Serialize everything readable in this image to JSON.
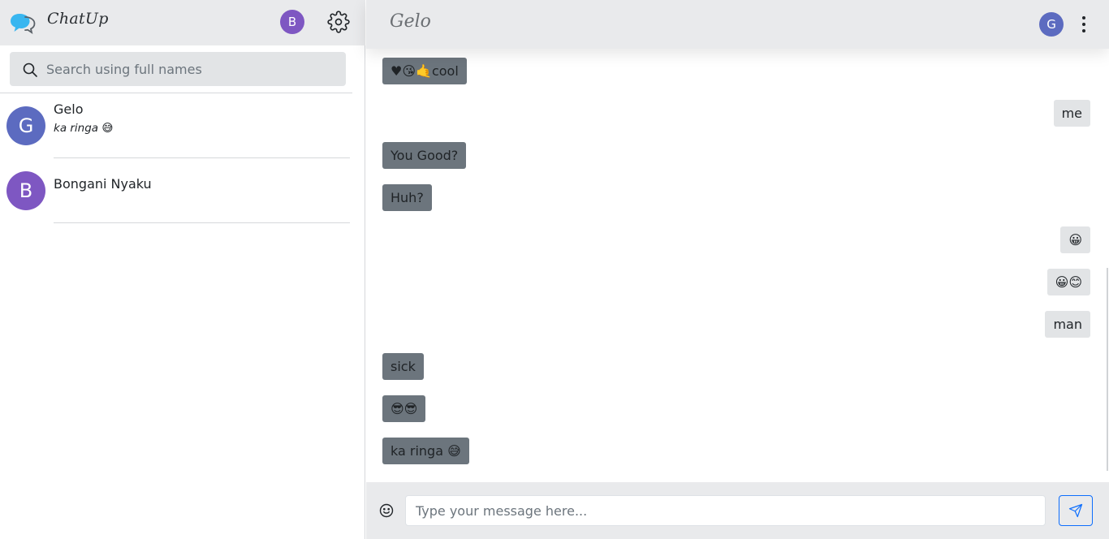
{
  "app": {
    "title": "ChatUp"
  },
  "current_user": {
    "initial": "B"
  },
  "search": {
    "placeholder": "Search using full names",
    "value": ""
  },
  "contacts": [
    {
      "initial": "G",
      "name": "Gelo",
      "preview": "ka ringa 😅",
      "avatar_color": "#5c6bc0"
    },
    {
      "initial": "B",
      "name": "Bongani Nyaku",
      "preview": "",
      "avatar_color": "#7e57c2"
    }
  ],
  "chat": {
    "title": "Gelo",
    "avatar_initial": "G",
    "messages": [
      {
        "direction": "in",
        "text": "♥😘🤙cool"
      },
      {
        "direction": "out",
        "text": "me"
      },
      {
        "direction": "in",
        "text": "You Good?"
      },
      {
        "direction": "in",
        "text": "Huh?"
      },
      {
        "direction": "out",
        "text": "😀"
      },
      {
        "direction": "out",
        "text": "😀😊"
      },
      {
        "direction": "out",
        "text": "man"
      },
      {
        "direction": "in",
        "text": "sick"
      },
      {
        "direction": "in",
        "text": "😎😎"
      },
      {
        "direction": "in",
        "text": "ka ringa 😅"
      }
    ]
  },
  "composer": {
    "placeholder": "Type your message here...",
    "value": ""
  },
  "icons": {
    "logo": "chat-bubbles-icon",
    "settings": "gear-icon",
    "search": "search-icon",
    "menu": "more-vertical-icon",
    "emoji": "smiley-icon",
    "send": "send-icon"
  },
  "colors": {
    "incoming_bubble": "#6c757d",
    "outgoing_bubble": "#e2e4e6",
    "header_bg": "#e9eaec",
    "send_accent": "#0d6efd"
  }
}
